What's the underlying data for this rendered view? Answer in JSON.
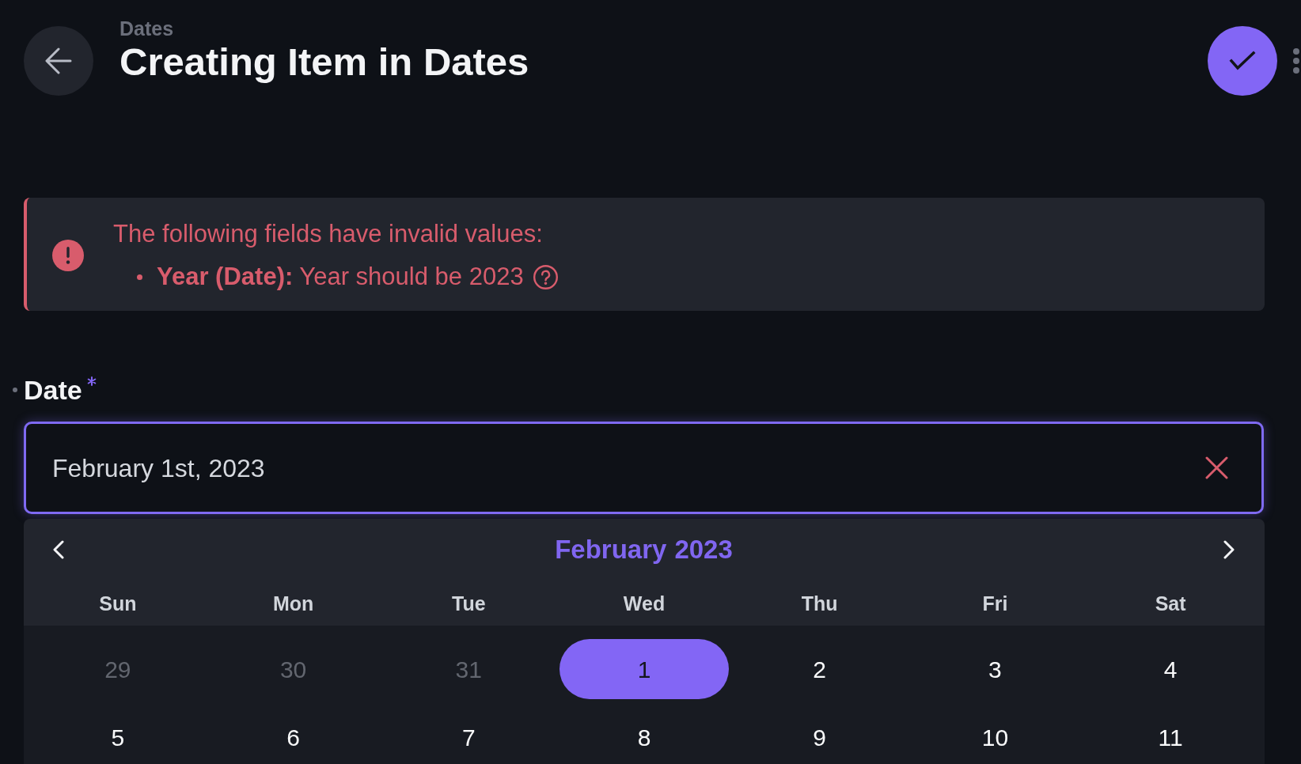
{
  "header": {
    "breadcrumb": "Dates",
    "title": "Creating Item in Dates"
  },
  "alert": {
    "message": "The following fields have invalid values:",
    "errors": [
      {
        "text": "**Year (Date):** Year should be 2023"
      }
    ]
  },
  "fields": [
    {
      "label": "Date",
      "required": true,
      "value": "February 1st, 2023",
      "focused": true
    }
  ],
  "calendar": {
    "month": "February",
    "year": "2023",
    "weekdays": [
      "Sun",
      "Mon",
      "Tue",
      "Wed",
      "Thu",
      "Fri",
      "Sat"
    ],
    "weeks": [
      [
        {
          "label": "29",
          "outside": true,
          "selected": false
        },
        {
          "label": "30",
          "outside": true,
          "selected": false
        },
        {
          "label": "31",
          "outside": true,
          "selected": false
        },
        {
          "label": "1",
          "outside": false,
          "selected": true
        },
        {
          "label": "2",
          "outside": false,
          "selected": false
        },
        {
          "label": "3",
          "outside": false,
          "selected": false
        },
        {
          "label": "4",
          "outside": false,
          "selected": false
        }
      ],
      [
        {
          "label": "5",
          "outside": false,
          "selected": false
        },
        {
          "label": "6",
          "outside": false,
          "selected": false
        },
        {
          "label": "7",
          "outside": false,
          "selected": false
        },
        {
          "label": "8",
          "outside": false,
          "selected": false
        },
        {
          "label": "9",
          "outside": false,
          "selected": false
        },
        {
          "label": "10",
          "outside": false,
          "selected": false
        },
        {
          "label": "11",
          "outside": false,
          "selected": false
        }
      ]
    ]
  }
}
